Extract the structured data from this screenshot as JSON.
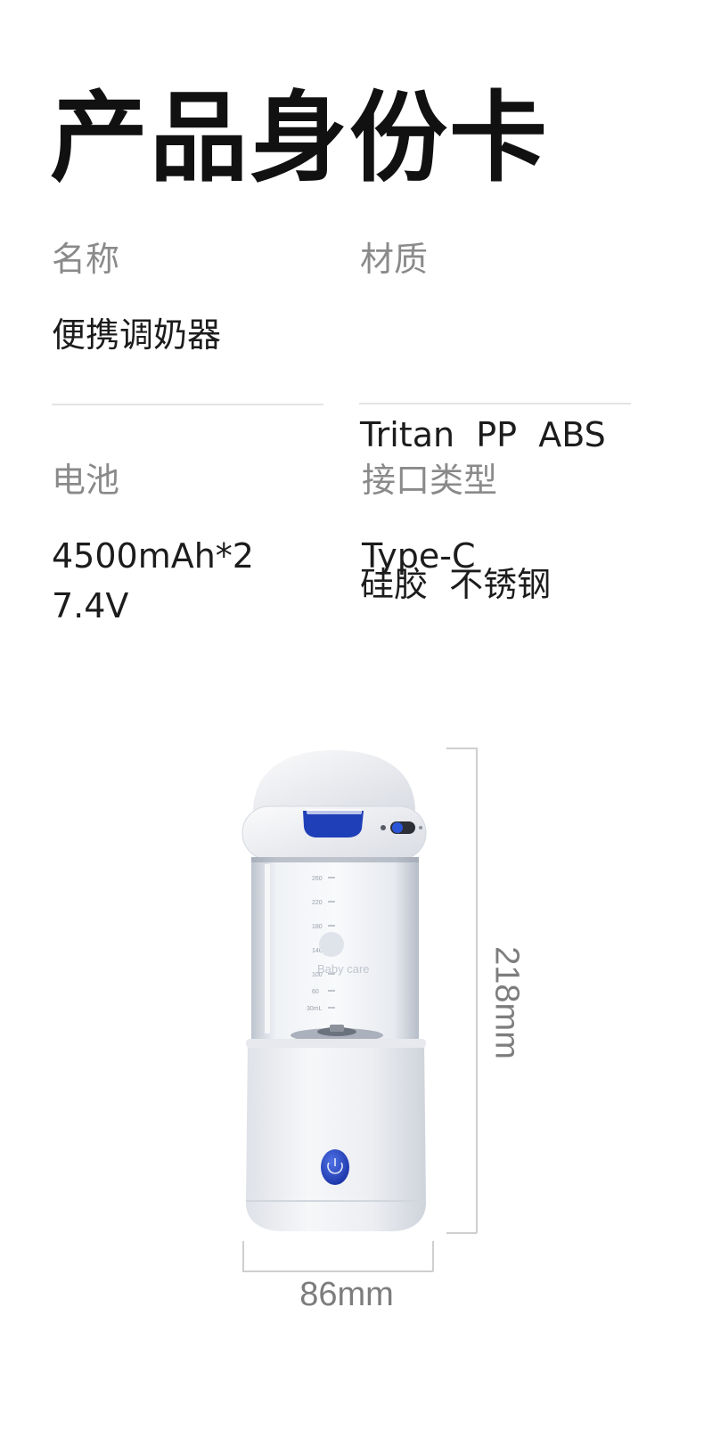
{
  "title": "产品身份卡",
  "specs": {
    "name": {
      "label": "名称",
      "value_lines": [
        "便携调奶器"
      ]
    },
    "material": {
      "label": "材质",
      "value_lines": [
        "Tritan  PP  ABS",
        "硅胶  不锈钢"
      ]
    },
    "battery": {
      "label": "电池",
      "value_lines": [
        "4500mAh*2",
        "7.4V"
      ]
    },
    "interface": {
      "label": "接口类型",
      "value_lines": [
        "Type-C"
      ]
    }
  },
  "product_image": {
    "brand_mark": "Baby care",
    "scale_marks": [
      "260",
      "220",
      "180",
      "140",
      "100",
      "60",
      "30mL"
    ],
    "accent_color": "#1f3fb8",
    "body_color": "#eef0f4"
  },
  "dimensions": {
    "height": "218mm",
    "width": "86mm"
  }
}
